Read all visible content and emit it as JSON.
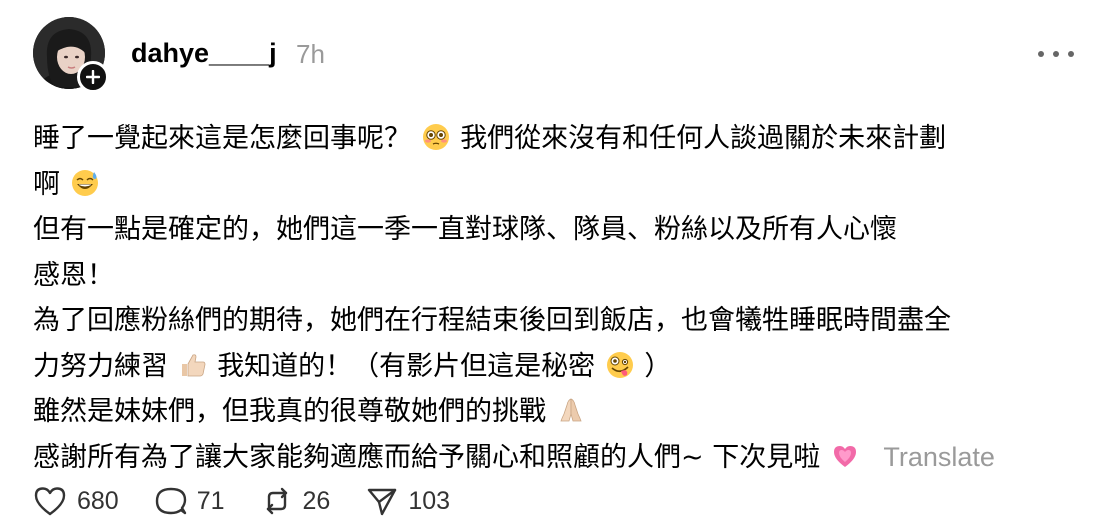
{
  "post": {
    "username": "dahye____j",
    "timestamp": "7h",
    "lines": [
      "睡了一覺起來這是怎麼回事呢？",
      "我們從來沒有和任何人談過關於未來計劃",
      "啊",
      "但有一點是確定的，她們這一季一直對球隊、隊員、粉絲以及所有人心懷",
      "感恩！",
      "為了回應粉絲們的期待，她們在行程結束後回到飯店，也會犧牲睡眠時間盡全",
      "力努力練習",
      "我知道的！（有影片但這是秘密",
      "）",
      "雖然是妹妹們，但我真的很尊敬她們的挑戰",
      "感謝所有為了讓大家能夠適應而給予關心和照顧的人們~ 下次見啦"
    ],
    "translate_label": "Translate"
  },
  "icons": {
    "follow": "plus-icon",
    "more": "more-icon",
    "like": "heart-icon",
    "reply": "comment-icon",
    "repost": "repost-icon",
    "share": "send-icon",
    "emoji_flushed": "flushed-face-emoji",
    "emoji_sweat": "grinning-sweat-emoji",
    "emoji_thumbs": "thumbs-up-emoji",
    "emoji_zany": "zany-face-emoji",
    "emoji_pray": "folded-hands-emoji",
    "emoji_heart": "growing-heart-emoji"
  },
  "actions": {
    "likes": "680",
    "replies": "71",
    "reposts": "26",
    "shares": "103"
  },
  "colors": {
    "text": "#000000",
    "muted": "#9a9a9a",
    "icon": "#333333",
    "badge": "#111111"
  }
}
